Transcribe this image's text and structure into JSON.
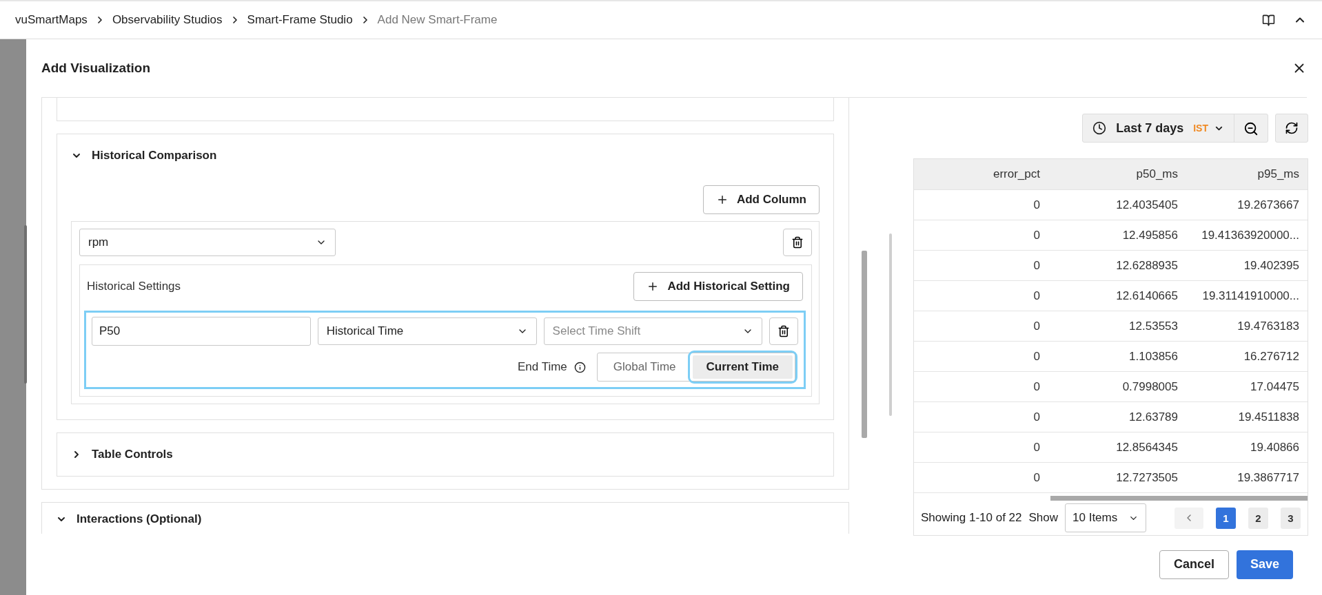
{
  "breadcrumb": [
    {
      "label": "vuSmartMaps",
      "current": false
    },
    {
      "label": "Observability Studios",
      "current": false
    },
    {
      "label": "Smart-Frame Studio",
      "current": false
    },
    {
      "label": "Add New Smart-Frame",
      "current": true
    }
  ],
  "modal": {
    "title": "Add Visualization"
  },
  "sections": [
    {
      "title": "Historical Comparison",
      "expanded": true,
      "add_column_button": "Add Column",
      "columns": [
        {
          "field": "rpm",
          "settings_label": "Historical Settings",
          "add_setting_button": "Add Historical Setting",
          "settings": [
            {
              "name": "P50",
              "mode": "Historical Time",
              "time_shift_placeholder": "Select Time Shift",
              "end_time_label": "End Time",
              "highlighted": true,
              "end_time_options": [
                {
                  "label": "Global Time",
                  "selected": false,
                  "highlighted": false
                },
                {
                  "label": "Current Time",
                  "selected": true,
                  "highlighted": true
                }
              ]
            }
          ]
        }
      ]
    },
    {
      "title": "Table Controls",
      "expanded": false
    }
  ],
  "interactions": {
    "title": "Interactions (Optional)",
    "expanded": true
  },
  "time_range": {
    "label": "Last 7 days",
    "zone": "IST"
  },
  "table": {
    "columns": [
      "error_pct",
      "p50_ms",
      "p95_ms"
    ],
    "rows": [
      [
        "0",
        "12.4035405",
        "19.2673667"
      ],
      [
        "0",
        "12.495856",
        "19.41363920000..."
      ],
      [
        "0",
        "12.6288935",
        "19.402395"
      ],
      [
        "0",
        "12.6140665",
        "19.31141910000..."
      ],
      [
        "0",
        "12.53553",
        "19.4763183"
      ],
      [
        "0",
        "1.103856",
        "16.276712"
      ],
      [
        "0",
        "0.7998005",
        "17.04475"
      ],
      [
        "0",
        "12.63789",
        "19.4511838"
      ],
      [
        "0",
        "12.8564345",
        "19.40866"
      ],
      [
        "0",
        "12.7273505",
        "19.3867717"
      ]
    ]
  },
  "pagination": {
    "showing": "Showing 1-10 of 22",
    "show_label": "Show",
    "page_size": "10 Items",
    "pages": [
      {
        "label": "1",
        "selected": true
      },
      {
        "label": "2",
        "selected": false
      },
      {
        "label": "3",
        "selected": false
      }
    ]
  },
  "buttons": {
    "cancel": "Cancel",
    "save": "Save"
  }
}
